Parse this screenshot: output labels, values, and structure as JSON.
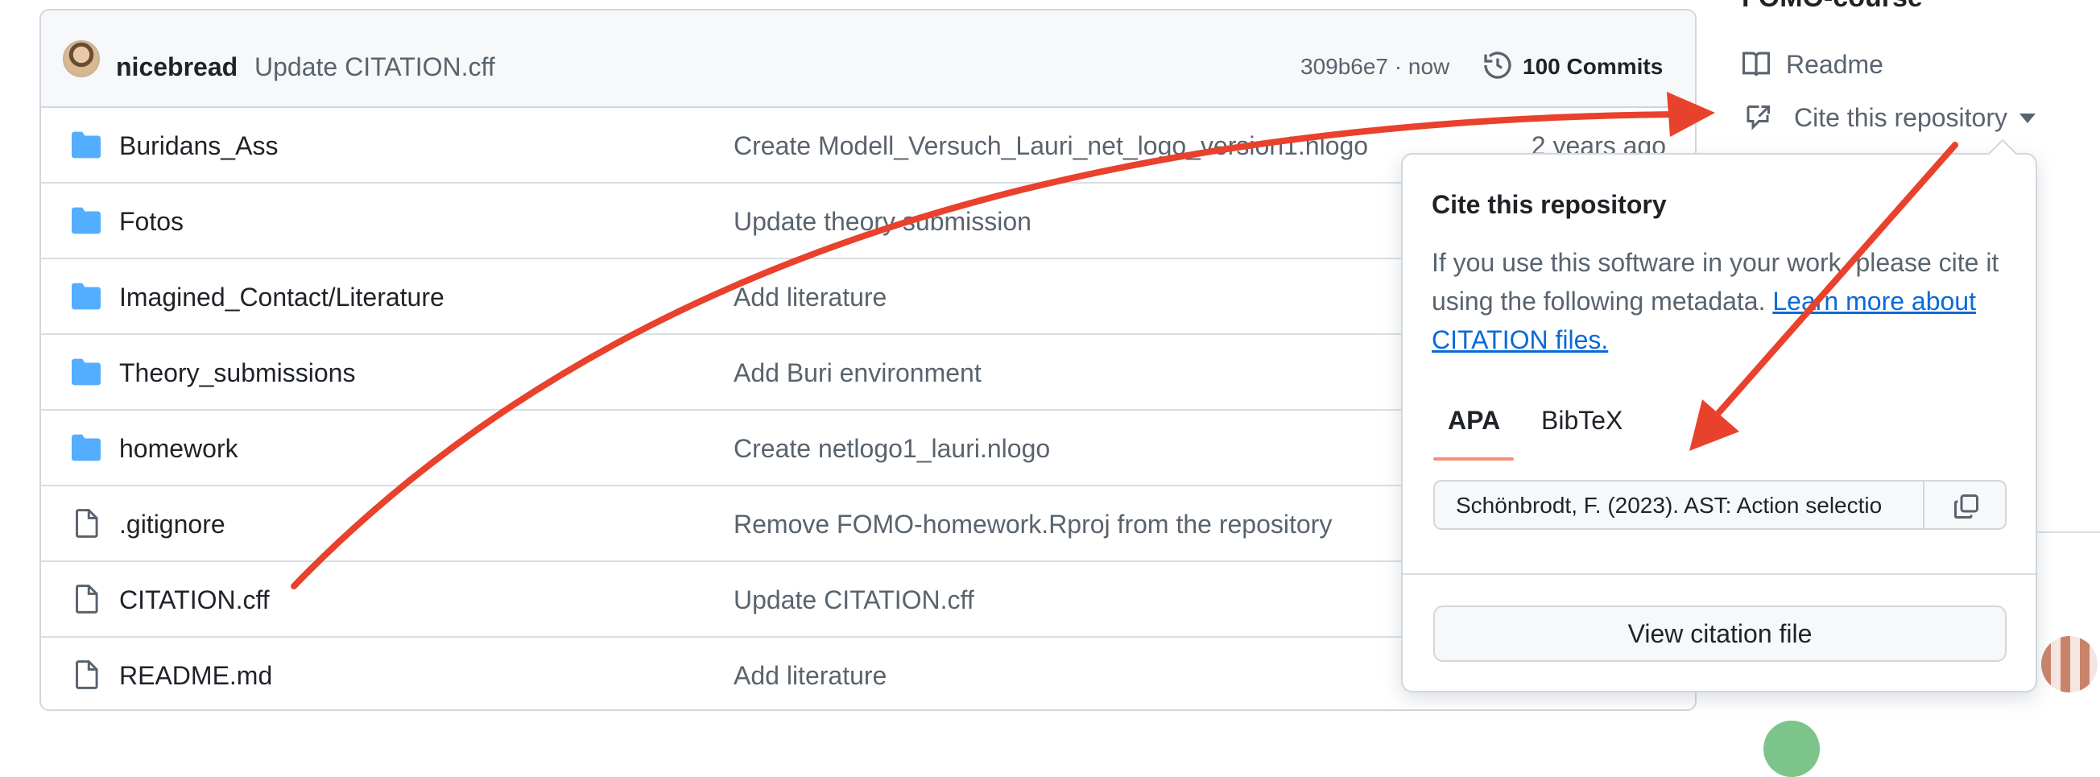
{
  "commit_bar": {
    "author": "nicebread",
    "message": "Update CITATION.cff",
    "sha_time": "309b6e7 · now",
    "commits_label": "100 Commits",
    "history_icon": "history-icon"
  },
  "files": [
    {
      "name": "Buridans_Ass",
      "type": "folder",
      "message": "Create Modell_Versuch_Lauri_net_logo_version1.nlogo",
      "time": "2 years ago"
    },
    {
      "name": "Fotos",
      "type": "folder",
      "message": "Update theory submission",
      "time": ""
    },
    {
      "name": "Imagined_Contact/Literature",
      "type": "folder",
      "message": "Add literature",
      "time": ""
    },
    {
      "name": "Theory_submissions",
      "type": "folder",
      "message": "Add Buri environment",
      "time": ""
    },
    {
      "name": "homework",
      "type": "folder",
      "message": "Create netlogo1_lauri.nlogo",
      "time": ""
    },
    {
      "name": ".gitignore",
      "type": "file",
      "message": "Remove FOMO-homework.Rproj from the repository",
      "time": ""
    },
    {
      "name": "CITATION.cff",
      "type": "file",
      "message": "Update CITATION.cff",
      "time": ""
    },
    {
      "name": "README.md",
      "type": "file",
      "message": "Add literature",
      "time": ""
    }
  ],
  "sidebar": {
    "title_partial": "FOMO-course",
    "readme_label": "Readme",
    "cite_label": "Cite this repository"
  },
  "popover": {
    "title": "Cite this repository",
    "desc_text": "If you use this software in your work, please cite it using the following metadata. ",
    "desc_link": "Learn more about CITATION files.",
    "tabs": [
      "APA",
      "BibTeX"
    ],
    "citation_value": "Schönbrodt, F. (2023). AST: Action selectio",
    "view_button": "View citation file"
  },
  "colors": {
    "annotation_arrow": "#e8412c",
    "folder": "#54aeff",
    "link": "#0969da",
    "tab_underline": "#fd8c73"
  }
}
